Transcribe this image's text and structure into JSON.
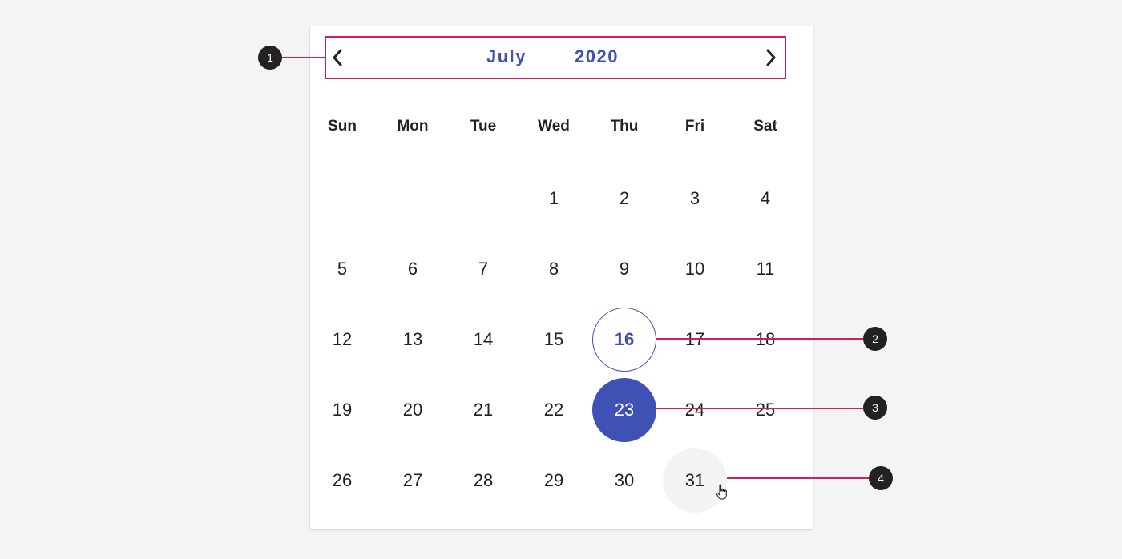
{
  "calendar": {
    "month": "July",
    "year": "2020",
    "weekdays": [
      "Sun",
      "Mon",
      "Tue",
      "Wed",
      "Thu",
      "Fri",
      "Sat"
    ],
    "first_weekday_index": 3,
    "days_in_month": 31,
    "today": 16,
    "selected": 23,
    "hovered": 31,
    "prev_icon": "chevron-left-icon",
    "next_icon": "chevron-right-icon"
  },
  "annotations": {
    "labels": [
      "1",
      "2",
      "3",
      "4"
    ]
  },
  "colors": {
    "accent": "#3f51b5",
    "callout": "#d81b60",
    "badge": "#222222",
    "hover": "#f3f3f3",
    "background": "#f4f4f4"
  }
}
